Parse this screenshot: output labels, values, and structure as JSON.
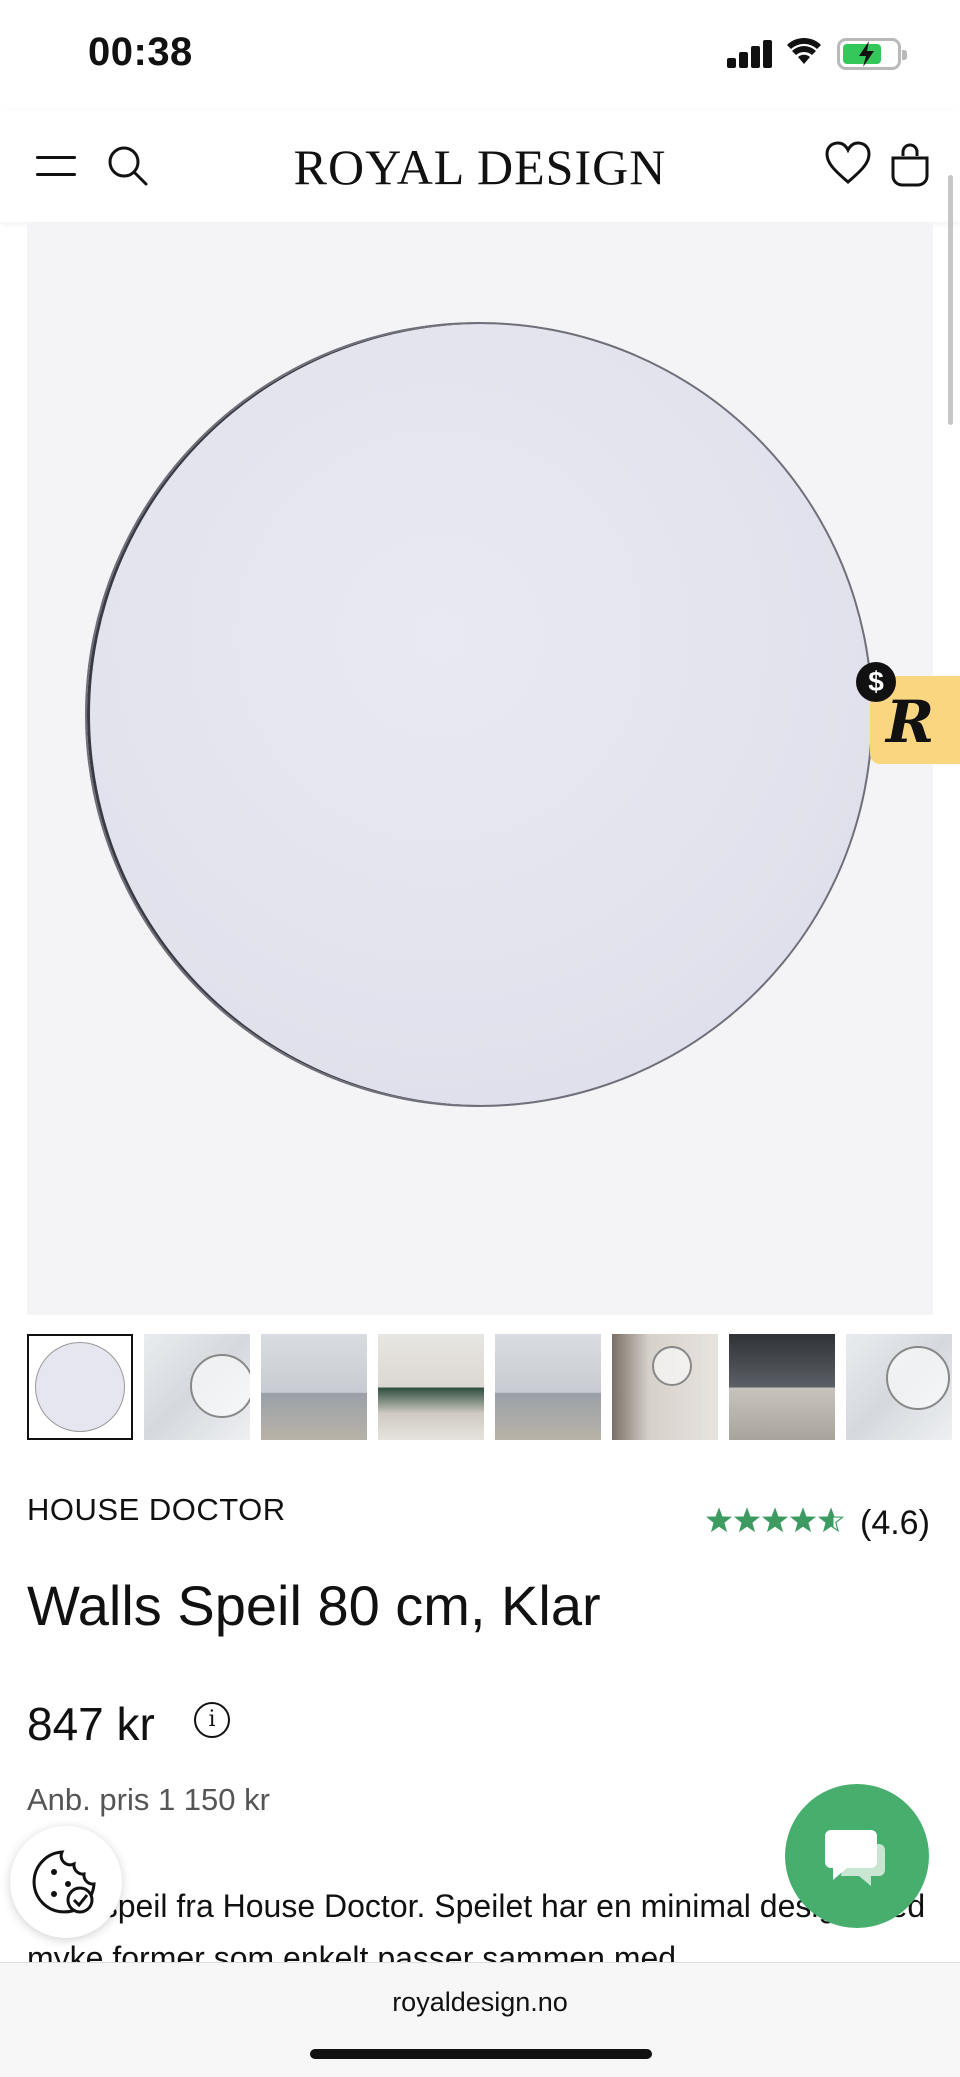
{
  "status_bar": {
    "time": "00:38"
  },
  "header": {
    "brand": "ROYAL DESIGN"
  },
  "product": {
    "brand": "HOUSE DOCTOR",
    "rating": 4.6,
    "rating_label": "(4.6)",
    "title": "Walls Speil 80 cm, Klar",
    "price": "847 kr",
    "recommended_price": "Anb. pris 1 150 kr",
    "description": "Klart speil fra House Doctor. Speilet har en minimal design med myke former som enkelt passer sammen med"
  },
  "thumbnails": [
    "mirror-clear",
    "mirror-marble-wall",
    "living-room",
    "living-room-green-sofa",
    "living-room-wide",
    "hallway",
    "living-room-dark",
    "mirror-marble-wall-2"
  ],
  "badge": {
    "letter": "R",
    "currency_symbol": "$"
  },
  "browser": {
    "url": "royaldesign.no"
  },
  "colors": {
    "accent_green": "#47ae6d",
    "star_green": "#3d9b62",
    "reward_yellow": "#fad680"
  }
}
